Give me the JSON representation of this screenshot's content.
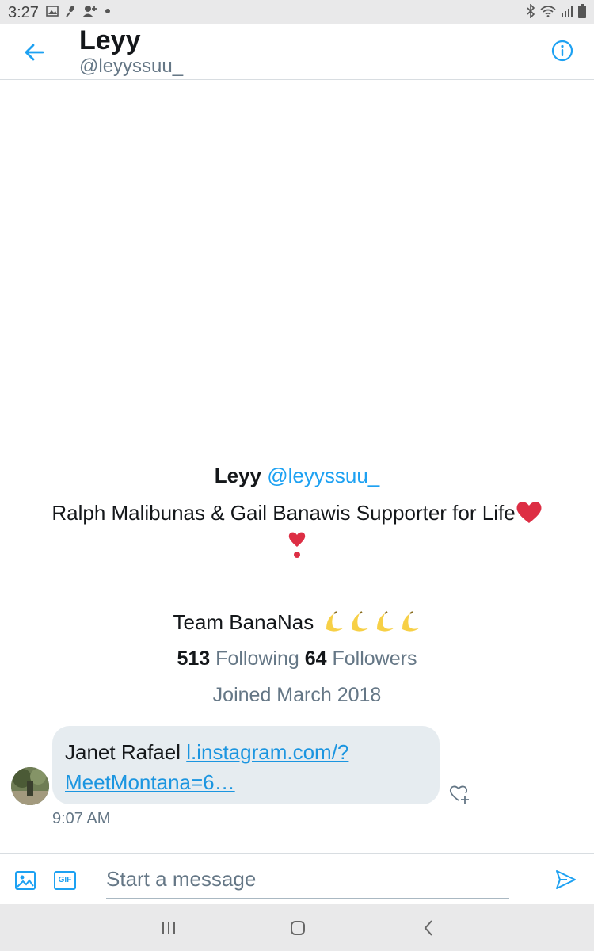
{
  "status_bar": {
    "time": "3:27",
    "left_icons": [
      "gallery-icon",
      "mic-off-icon",
      "person-add-icon",
      "dot-icon"
    ],
    "right_icons": [
      "bluetooth-icon",
      "wifi-icon",
      "signal-icon",
      "battery-icon"
    ]
  },
  "header": {
    "name": "Leyy",
    "handle": "@leyyssuu_"
  },
  "profile": {
    "name": "Leyy",
    "handle": "@leyyssuu_",
    "bio_line1": "Ralph Malibunas & Gail Banawis Supporter for Life",
    "bio_line2": "Team BanaNas",
    "following_count": "513",
    "following_label": "Following",
    "followers_count": "64",
    "followers_label": "Followers",
    "joined": "Joined March 2018"
  },
  "message": {
    "sender": "Janet Rafael",
    "link_line1": "l.instagram.com/?",
    "link_line2": "MeetMontana=6…",
    "time": "9:07 AM"
  },
  "composer": {
    "placeholder": "Start a message",
    "gif_label": "GIF"
  },
  "colors": {
    "accent": "#1da1f2",
    "heart": "#e0245e",
    "text_secondary": "#657786",
    "bubble": "#e6ecf0"
  }
}
